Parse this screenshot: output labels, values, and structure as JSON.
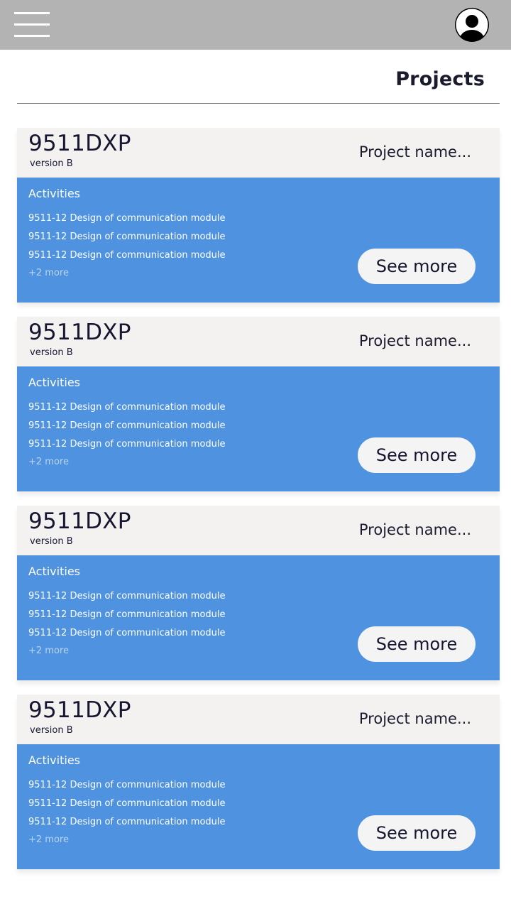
{
  "header": {
    "menu_icon": "hamburger-menu-icon",
    "avatar_icon": "user-account-icon",
    "bar_color": "#b3b3b3"
  },
  "page": {
    "title": "Projects"
  },
  "projects": [
    {
      "code": "9511DXP",
      "version": "version B",
      "name": "Project name...",
      "activities_label": "Activities",
      "activities": [
        "9511-12 Design of communication module",
        "9511-12 Design of communication module",
        "9511-12 Design of communication module"
      ],
      "more_count": "+2 more",
      "see_more_label": "See more"
    },
    {
      "code": "9511DXP",
      "version": "version B",
      "name": "Project name...",
      "activities_label": "Activities",
      "activities": [
        "9511-12 Design of communication module",
        "9511-12 Design of communication module",
        "9511-12 Design of communication module"
      ],
      "more_count": "+2 more",
      "see_more_label": "See more"
    },
    {
      "code": "9511DXP",
      "version": "version B",
      "name": "Project name...",
      "activities_label": "Activities",
      "activities": [
        "9511-12 Design of communication module",
        "9511-12 Design of communication module",
        "9511-12 Design of communication module"
      ],
      "more_count": "+2 more",
      "see_more_label": "See more"
    },
    {
      "code": "9511DXP",
      "version": "version B",
      "name": "Project name...",
      "activities_label": "Activities",
      "activities": [
        "9511-12 Design of communication module",
        "9511-12 Design of communication module",
        "9511-12 Design of communication module"
      ],
      "more_count": "+2 more",
      "see_more_label": "See more"
    }
  ],
  "colors": {
    "card_header": "#f3f2f1",
    "card_body": "#4f93e0",
    "button": "#f4f4f4"
  }
}
